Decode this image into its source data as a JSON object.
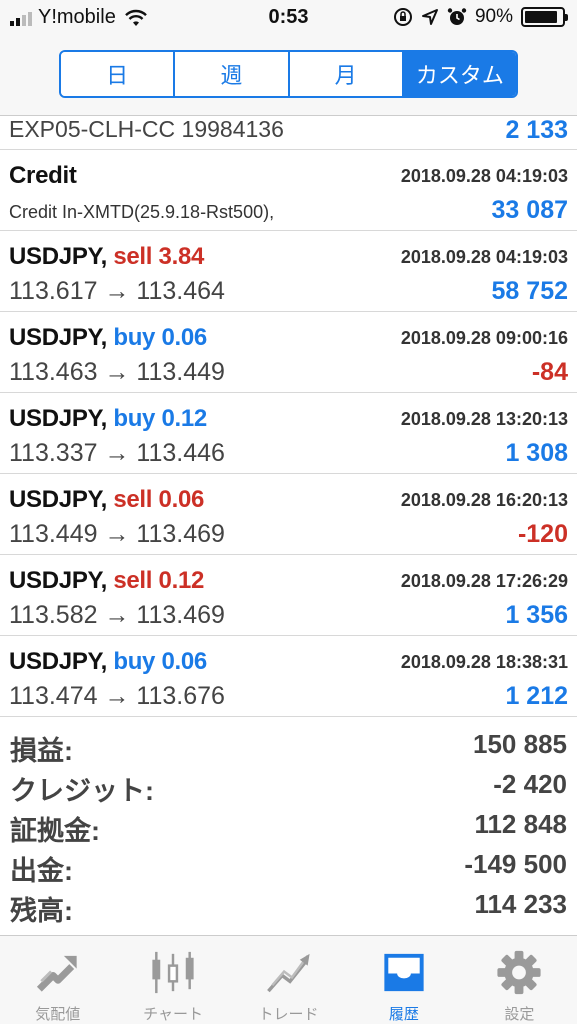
{
  "status_bar": {
    "carrier": "Y!mobile",
    "time": "0:53",
    "battery": "90%",
    "battery_level": 0.9
  },
  "period_tabs": {
    "items": [
      {
        "label": "日",
        "active": false
      },
      {
        "label": "週",
        "active": false
      },
      {
        "label": "月",
        "active": false
      },
      {
        "label": "カスタム",
        "active": true
      }
    ]
  },
  "history": {
    "partial_row": {
      "description": "EXP05-CLH-CC 19984136",
      "amount": "2 133"
    },
    "credit_row": {
      "title": "Credit",
      "date": "2018.09.28 04:19:03",
      "description": "Credit In-XMTD(25.9.18-Rst500),",
      "amount": "33 087"
    },
    "trades": [
      {
        "symbol": "USDJPY,",
        "side": "sell 3.84",
        "date": "2018.09.28 04:19:03",
        "prices": "113.617 → 113.464",
        "profit": "58 752",
        "direction": "sell",
        "sign": "pos"
      },
      {
        "symbol": "USDJPY,",
        "side": "buy 0.06",
        "date": "2018.09.28 09:00:16",
        "prices": "113.463 → 113.449",
        "profit": "-84",
        "direction": "buy",
        "sign": "neg"
      },
      {
        "symbol": "USDJPY,",
        "side": "buy 0.12",
        "date": "2018.09.28 13:20:13",
        "prices": "113.337 → 113.446",
        "profit": "1 308",
        "direction": "buy",
        "sign": "pos"
      },
      {
        "symbol": "USDJPY,",
        "side": "sell 0.06",
        "date": "2018.09.28 16:20:13",
        "prices": "113.449 → 113.469",
        "profit": "-120",
        "direction": "sell",
        "sign": "neg"
      },
      {
        "symbol": "USDJPY,",
        "side": "sell 0.12",
        "date": "2018.09.28 17:26:29",
        "prices": "113.582 → 113.469",
        "profit": "1 356",
        "direction": "sell",
        "sign": "pos"
      },
      {
        "symbol": "USDJPY,",
        "side": "buy 0.06",
        "date": "2018.09.28 18:38:31",
        "prices": "113.474 → 113.676",
        "profit": "1 212",
        "direction": "buy",
        "sign": "pos"
      }
    ]
  },
  "summary": [
    {
      "label": "損益:",
      "value": "150 885"
    },
    {
      "label": "クレジット:",
      "value": "-2 420"
    },
    {
      "label": "証拠金:",
      "value": "112 848"
    },
    {
      "label": "出金:",
      "value": "-149 500"
    },
    {
      "label": "残高:",
      "value": "114 233"
    }
  ],
  "tab_bar": {
    "items": [
      {
        "label": "気配値",
        "icon": "quotes-icon",
        "active": false
      },
      {
        "label": "チャート",
        "icon": "chart-icon",
        "active": false
      },
      {
        "label": "トレード",
        "icon": "trade-icon",
        "active": false
      },
      {
        "label": "履歴",
        "icon": "history-icon",
        "active": true
      },
      {
        "label": "設定",
        "icon": "settings-icon",
        "active": false
      }
    ]
  },
  "colors": {
    "accent": "#1a7ae6",
    "sell": "#cc3026",
    "positive": "#1a7ae6",
    "negative": "#cc3026"
  }
}
